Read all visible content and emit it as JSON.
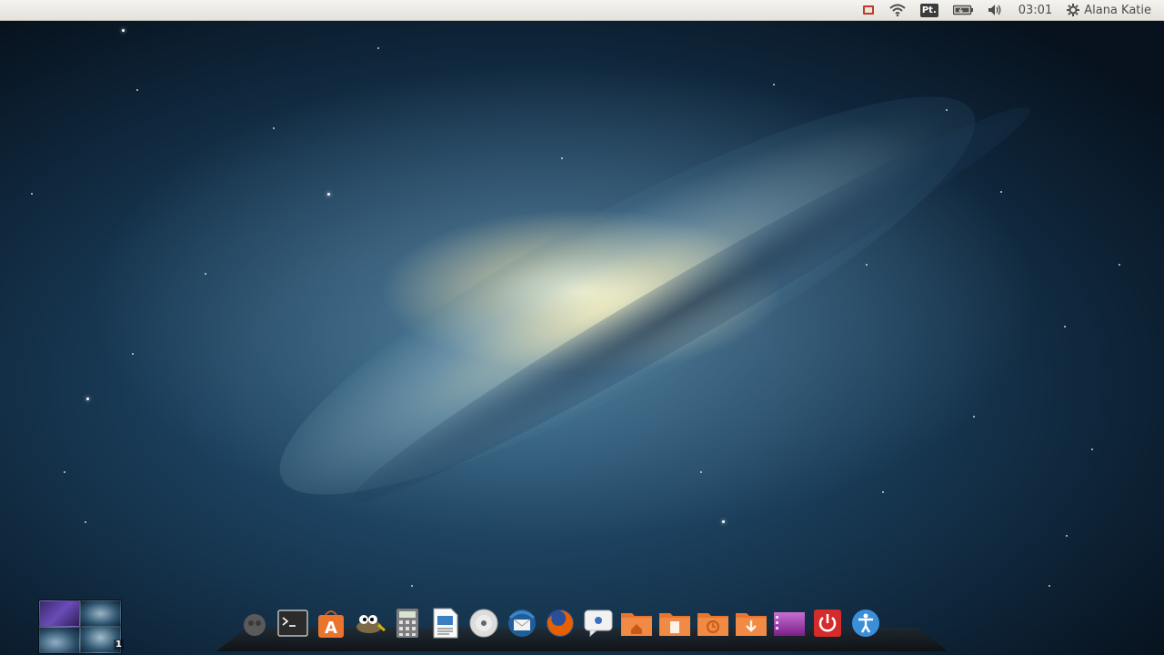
{
  "top_panel": {
    "clock": "03:01",
    "user_name": "Alana Katie",
    "keyboard_layout": "Pt.",
    "tray_icons": [
      "mail-indicator-icon",
      "wifi-icon",
      "keyboard-layout-icon",
      "battery-icon",
      "volume-icon",
      "gear-icon"
    ]
  },
  "workspace_switcher": {
    "current": "1"
  },
  "dock": {
    "items": [
      {
        "name": "gimp-icon-left"
      },
      {
        "name": "terminal-icon"
      },
      {
        "name": "software-center-icon"
      },
      {
        "name": "gimp-icon"
      },
      {
        "name": "calculator-icon"
      },
      {
        "name": "document-viewer-icon"
      },
      {
        "name": "disc-icon"
      },
      {
        "name": "thunderbird-icon"
      },
      {
        "name": "firefox-icon"
      },
      {
        "name": "chat-icon"
      },
      {
        "name": "home-folder-icon"
      },
      {
        "name": "documents-folder-icon"
      },
      {
        "name": "backup-folder-icon"
      },
      {
        "name": "downloads-folder-icon"
      },
      {
        "name": "video-folder-icon"
      },
      {
        "name": "power-icon"
      },
      {
        "name": "accessibility-icon"
      }
    ]
  },
  "colors": {
    "panel": "#e9e7e2",
    "orange_folder": "#e8742e",
    "power_red": "#d62b2b",
    "accessibility_blue": "#3b8fd9"
  }
}
